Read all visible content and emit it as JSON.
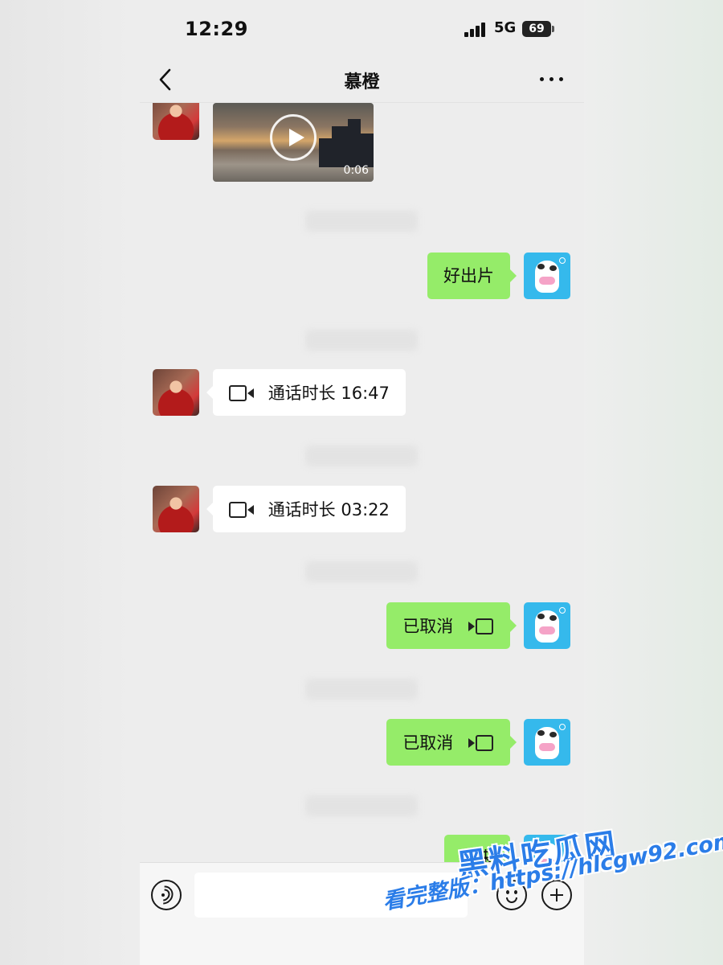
{
  "status_bar": {
    "time": "12:29",
    "network": "5G",
    "battery": "69"
  },
  "nav": {
    "title": "慕橙",
    "back_icon": "chevron-left-icon",
    "more_icon": "more-dots-icon"
  },
  "messages": [
    {
      "type": "video",
      "side": "left",
      "duration": "0:06"
    },
    {
      "type": "text",
      "side": "right",
      "text": "好出片"
    },
    {
      "type": "call",
      "side": "left",
      "text": "通话时长 16:47"
    },
    {
      "type": "call",
      "side": "left",
      "text": "通话时长 03:22"
    },
    {
      "type": "call",
      "side": "right",
      "text": "已取消"
    },
    {
      "type": "call",
      "side": "right",
      "text": "已取消"
    },
    {
      "type": "text",
      "side": "right",
      "text": "回来"
    }
  ],
  "input_bar": {
    "voice_icon": "voice-icon",
    "emoji_icon": "emoji-icon",
    "plus_icon": "plus-icon"
  },
  "watermark": {
    "logo_text": "黑料吃瓜网",
    "url_text": "看完整版：https://hlcgw92.com"
  },
  "colors": {
    "background": "#ededed",
    "bubble_green": "#95ec69",
    "bubble_white": "#ffffff",
    "watermark": "#2b7de8"
  }
}
